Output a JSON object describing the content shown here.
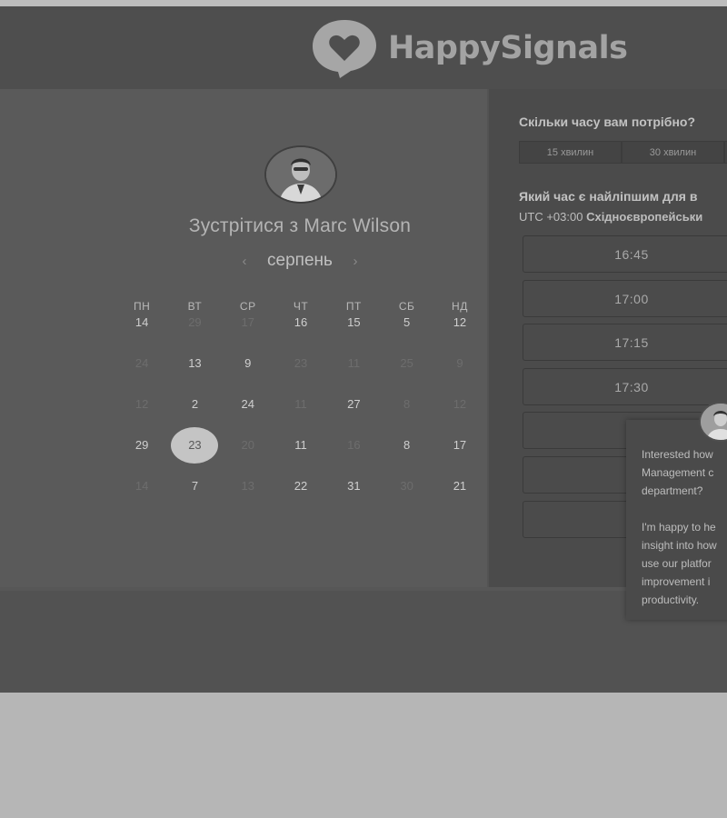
{
  "brand": {
    "name": "HappySignals"
  },
  "meeting": {
    "title": "Зустрітися з Marc Wilson",
    "month": "серпень",
    "prev_icon": "chevron-left-icon",
    "next_icon": "chevron-right-icon"
  },
  "calendar": {
    "weekdays": [
      "ПН",
      "ВТ",
      "СР",
      "ЧТ",
      "ПТ",
      "СБ",
      "НД"
    ],
    "rows": [
      [
        {
          "d": "14",
          "f": false
        },
        {
          "d": "29",
          "f": true
        },
        {
          "d": "17",
          "f": true
        },
        {
          "d": "16",
          "f": false
        },
        {
          "d": "15",
          "f": false
        },
        {
          "d": "5",
          "f": false
        },
        {
          "d": "12",
          "f": false
        }
      ],
      [
        {
          "d": "24",
          "f": true
        },
        {
          "d": "13",
          "f": false
        },
        {
          "d": "9",
          "f": false
        },
        {
          "d": "23",
          "f": true
        },
        {
          "d": "11",
          "f": true
        },
        {
          "d": "25",
          "f": true
        },
        {
          "d": "9",
          "f": true
        }
      ],
      [
        {
          "d": "12",
          "f": true
        },
        {
          "d": "2",
          "f": false
        },
        {
          "d": "24",
          "f": false
        },
        {
          "d": "11",
          "f": true
        },
        {
          "d": "27",
          "f": false
        },
        {
          "d": "8",
          "f": true
        },
        {
          "d": "12",
          "f": true
        }
      ],
      [
        {
          "d": "29",
          "f": false
        },
        {
          "d": "23",
          "f": false,
          "selected": true
        },
        {
          "d": "20",
          "f": true
        },
        {
          "d": "11",
          "f": false
        },
        {
          "d": "16",
          "f": true
        },
        {
          "d": "8",
          "f": false
        },
        {
          "d": "17",
          "f": false
        }
      ],
      [
        {
          "d": "14",
          "f": true
        },
        {
          "d": "7",
          "f": false
        },
        {
          "d": "13",
          "f": true
        },
        {
          "d": "22",
          "f": false
        },
        {
          "d": "31",
          "f": false
        },
        {
          "d": "30",
          "f": true
        },
        {
          "d": "21",
          "f": false
        }
      ]
    ]
  },
  "booking": {
    "duration_question": "Скільки часу вам потрібно?",
    "durations": [
      "15 хвилин",
      "30 хвилин"
    ],
    "time_question": "Який час є найліпшим для в",
    "tz_prefix": "UTC +03:00 ",
    "tz_name": "Східноєвропейськи",
    "slots": [
      "16:45",
      "17:00",
      "17:15",
      "17:30",
      "",
      "",
      "",
      ""
    ]
  },
  "chat": {
    "text": "Interested how\nManagement c\ndepartment?\n\nI'm happy to he\ninsight into how\nuse our platfor\nimprovement i\nproductivity."
  }
}
